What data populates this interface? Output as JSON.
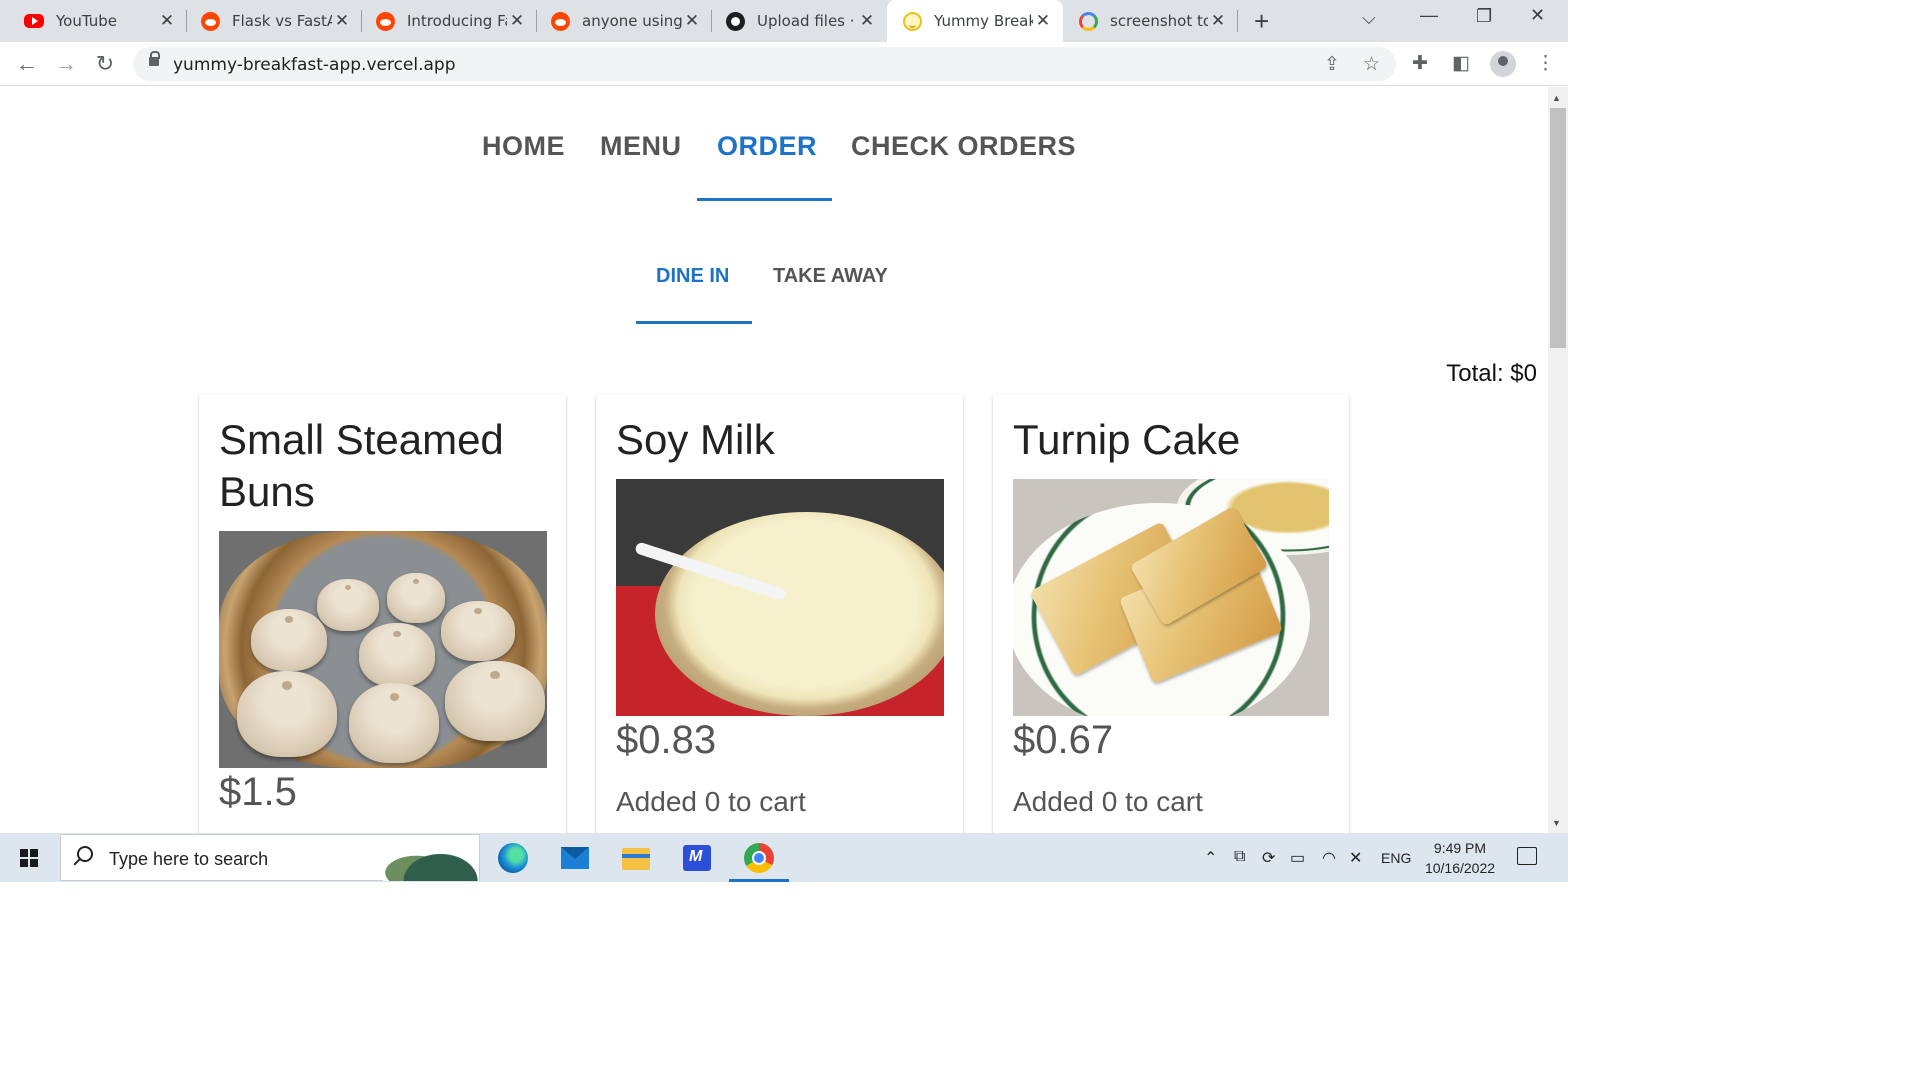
{
  "browser": {
    "tabs": [
      {
        "title": "YouTube",
        "icon": "youtube-icon",
        "active": false
      },
      {
        "title": "Flask vs FastAP",
        "icon": "reddit-icon",
        "active": false
      },
      {
        "title": "Introducing Fa",
        "icon": "reddit-icon",
        "active": false
      },
      {
        "title": "anyone using F",
        "icon": "reddit-icon",
        "active": false
      },
      {
        "title": "Upload files · d",
        "icon": "github-icon",
        "active": false
      },
      {
        "title": "Yummy Breakf",
        "icon": "smiley-icon",
        "active": true
      },
      {
        "title": "screenshot to f",
        "icon": "google-icon",
        "active": false
      }
    ],
    "new_tab_label": "+",
    "url": "yummy-breakfast-app.vercel.app"
  },
  "site": {
    "nav": [
      {
        "label": "HOME",
        "active": false
      },
      {
        "label": "MENU",
        "active": false
      },
      {
        "label": "ORDER",
        "active": true
      },
      {
        "label": "CHECK ORDERS",
        "active": false
      }
    ],
    "subnav": [
      {
        "label": "DINE IN",
        "active": true
      },
      {
        "label": "TAKE AWAY",
        "active": false
      }
    ],
    "total": "Total: $0",
    "products": [
      {
        "name": "Small Steamed Buns",
        "price": "$1.5",
        "image": "steamed-buns-photo"
      },
      {
        "name": "Soy Milk",
        "price": "$0.83",
        "cart_text": "Added 0 to cart",
        "image": "soy-milk-photo"
      },
      {
        "name": "Turnip Cake",
        "price": "$0.67",
        "cart_text": "Added 0 to cart",
        "image": "turnip-cake-photo"
      }
    ],
    "accent_color": "#1e73c8"
  },
  "taskbar": {
    "search_placeholder": "Type here to search",
    "language": "ENG",
    "time": "9:49 PM",
    "date": "10/16/2022"
  }
}
